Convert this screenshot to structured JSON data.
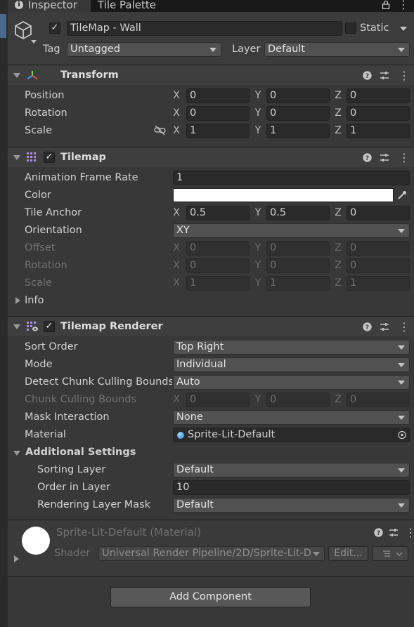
{
  "tabs": [
    {
      "label": "Inspector"
    },
    {
      "label": "Tile Palette"
    }
  ],
  "object": {
    "name": "TileMap - Wall",
    "static_label": "Static",
    "tag_label": "Tag",
    "tag_value": "Untagged",
    "layer_label": "Layer",
    "layer_value": "Default"
  },
  "transform": {
    "title": "Transform",
    "rows": [
      {
        "label": "Position",
        "x": "0",
        "y": "0",
        "z": "0"
      },
      {
        "label": "Rotation",
        "x": "0",
        "y": "0",
        "z": "0"
      },
      {
        "label": "Scale",
        "x": "1",
        "y": "1",
        "z": "1"
      }
    ]
  },
  "axes": {
    "x": "X",
    "y": "Y",
    "z": "Z"
  },
  "tilemap": {
    "title": "Tilemap",
    "anim_label": "Animation Frame Rate",
    "anim_value": "1",
    "color_label": "Color",
    "color_value": "#ffffff",
    "anchor_label": "Tile Anchor",
    "anchor_x": "0.5",
    "anchor_y": "0.5",
    "anchor_z": "0",
    "orientation_label": "Orientation",
    "orientation_value": "XY",
    "offset_label": "Offset",
    "offset": {
      "x": "0",
      "y": "0",
      "z": "0"
    },
    "rotation_label": "Rotation",
    "rotation": {
      "x": "0",
      "y": "0",
      "z": "0"
    },
    "scale_label": "Scale",
    "scale": {
      "x": "1",
      "y": "1",
      "z": "1"
    },
    "info_label": "Info"
  },
  "renderer": {
    "title": "Tilemap Renderer",
    "sort_label": "Sort Order",
    "sort_value": "Top Right",
    "mode_label": "Mode",
    "mode_value": "Individual",
    "detect_label": "Detect Chunk Culling Bounds",
    "detect_value": "Auto",
    "bounds_label": "Chunk Culling Bounds",
    "bounds": {
      "x": "0",
      "y": "0",
      "z": "0"
    },
    "mask_label": "Mask Interaction",
    "mask_value": "None",
    "material_label": "Material",
    "material_value": "Sprite-Lit-Default",
    "additional_label": "Additional Settings",
    "sorting_layer_label": "Sorting Layer",
    "sorting_layer_value": "Default",
    "order_label": "Order in Layer",
    "order_value": "10",
    "rlm_label": "Rendering Layer Mask",
    "rlm_value": "Default"
  },
  "material": {
    "title": "Sprite-Lit-Default (Material)",
    "shader_label": "Shader",
    "shader_value": "Universal Render Pipeline/2D/Sprite-Lit-D",
    "edit_label": "Edit..."
  },
  "add_component": "Add Component"
}
